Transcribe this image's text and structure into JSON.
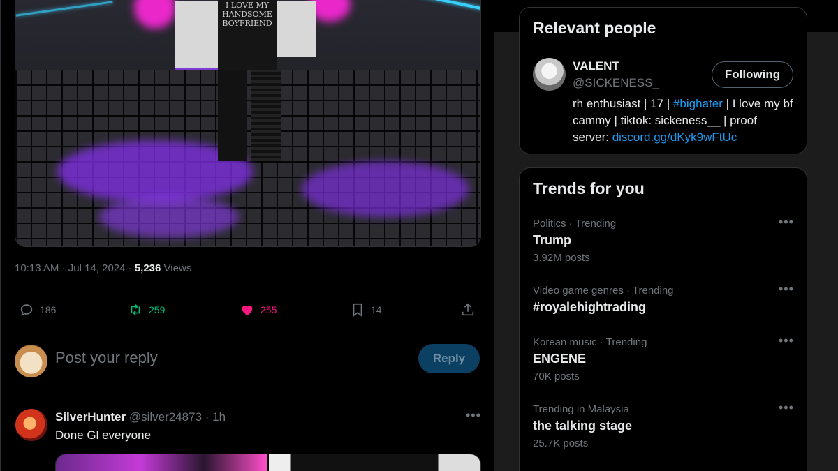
{
  "tweet": {
    "media_shirt_text": "I LOVE MY HANDSOME BOYFRIEND",
    "time": "10:13 AM",
    "date": "Jul 14, 2024",
    "views_count": "5,236",
    "views_label": "Views",
    "actions": {
      "replies": "186",
      "retweets": "259",
      "likes": "255",
      "bookmarks": "14"
    },
    "colors": {
      "retweet": "#00ba7c",
      "like": "#f91880"
    }
  },
  "composer": {
    "placeholder": "Post your reply",
    "reply_button": "Reply"
  },
  "reply": {
    "name": "SilverHunter",
    "handle": "@silver24873",
    "time": "1h",
    "text": "Done Gl everyone"
  },
  "relevant_people": {
    "title": "Relevant people",
    "person": {
      "name": "VALENT",
      "handle": "@SICKENESS_",
      "follow_label": "Following",
      "bio_pre": "rh enthusiast | 17 | ",
      "bio_hashtag": "#bighater",
      "bio_mid": " | I love my bf cammy | tiktok: sickeness__ | proof server: ",
      "bio_link": "discord.gg/dKyk9wFtUc"
    }
  },
  "trends": {
    "title": "Trends for you",
    "items": [
      {
        "category": "Politics · Trending",
        "name": "Trump",
        "count": "3.92M posts"
      },
      {
        "category": "Video game genres · Trending",
        "name": "#royalehightrading",
        "count": ""
      },
      {
        "category": "Korean music · Trending",
        "name": "ENGENE",
        "count": "70K posts"
      },
      {
        "category": "Trending in Malaysia",
        "name": "the talking stage",
        "count": "25.7K posts"
      }
    ]
  },
  "accent_color": "#1d9bf0"
}
